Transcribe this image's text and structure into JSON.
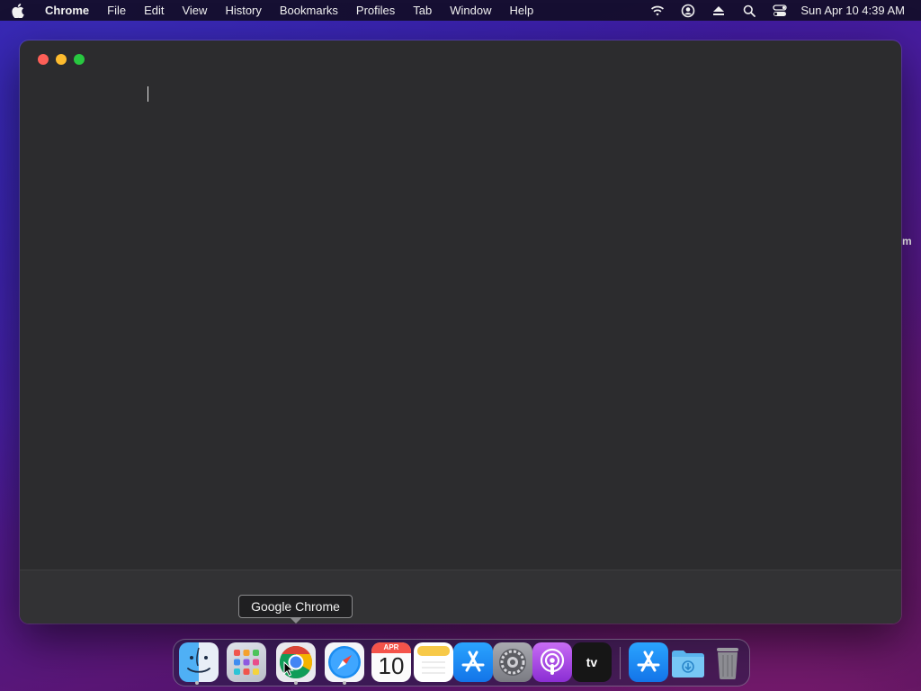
{
  "menubar": {
    "app_name": "Chrome",
    "items": [
      "File",
      "Edit",
      "View",
      "History",
      "Bookmarks",
      "Profiles",
      "Tab",
      "Window",
      "Help"
    ],
    "clock": "Sun Apr 10  4:39 AM",
    "status_icons": [
      "wifi-icon",
      "user-icon",
      "eject-icon",
      "search-icon",
      "control-center-icon"
    ]
  },
  "window": {
    "edge_text": "m"
  },
  "tooltip": {
    "label": "Google Chrome"
  },
  "dock": {
    "calendar_month": "APR",
    "calendar_day": "10",
    "tv_label": "tv",
    "apps": [
      "Finder",
      "Launchpad",
      "Google Chrome",
      "Safari",
      "Calendar",
      "Notes",
      "App Store",
      "System Preferences",
      "Podcasts",
      "TV",
      "App Store",
      "Downloads",
      "Trash"
    ],
    "running": [
      "Finder",
      "Google Chrome",
      "Safari"
    ]
  },
  "colors": {
    "close": "#fe5f57",
    "minimize": "#febc2e",
    "maximize": "#28c840",
    "window_bg": "#2c2c2e"
  }
}
